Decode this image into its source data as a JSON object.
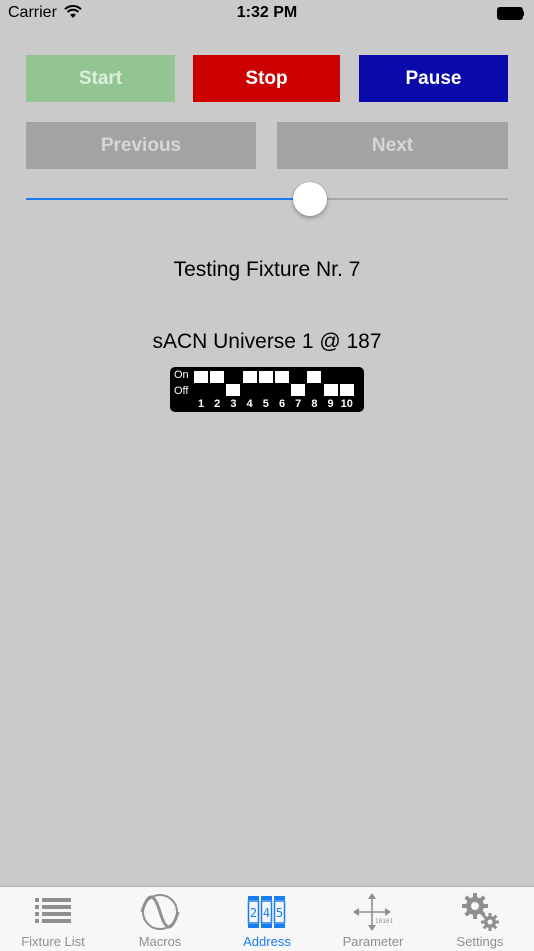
{
  "status_bar": {
    "carrier": "Carrier",
    "time": "1:32 PM"
  },
  "controls": {
    "start_label": "Start",
    "stop_label": "Stop",
    "pause_label": "Pause",
    "previous_label": "Previous",
    "next_label": "Next"
  },
  "slider": {
    "value": 0.59
  },
  "fixture": {
    "testing_text": "Testing Fixture Nr. 7",
    "address_text": "sACN Universe 1 @ 187"
  },
  "dip_switch": {
    "on_label": "On",
    "off_label": "Off",
    "switches": [
      {
        "num": "1",
        "on": true
      },
      {
        "num": "2",
        "on": true
      },
      {
        "num": "3",
        "on": false
      },
      {
        "num": "4",
        "on": true
      },
      {
        "num": "5",
        "on": true
      },
      {
        "num": "6",
        "on": true
      },
      {
        "num": "7",
        "on": false
      },
      {
        "num": "8",
        "on": true
      },
      {
        "num": "9",
        "on": false
      },
      {
        "num": "10",
        "on": false
      }
    ]
  },
  "tabs": [
    {
      "label": "Fixture List",
      "icon": "list-icon",
      "active": false
    },
    {
      "label": "Macros",
      "icon": "sine-wave-icon",
      "active": false
    },
    {
      "label": "Address",
      "icon": "address-counter-icon",
      "active": true,
      "digits": "245"
    },
    {
      "label": "Parameter",
      "icon": "parameter-arrows-icon",
      "active": false,
      "sub": "10101"
    },
    {
      "label": "Settings",
      "icon": "gears-icon",
      "active": false
    }
  ],
  "colors": {
    "accent": "#1a7cf0",
    "stop": "#cc0000",
    "pause": "#0a0aaa",
    "start_disabled": "#92c592",
    "nav_disabled": "#a3a3a3"
  }
}
